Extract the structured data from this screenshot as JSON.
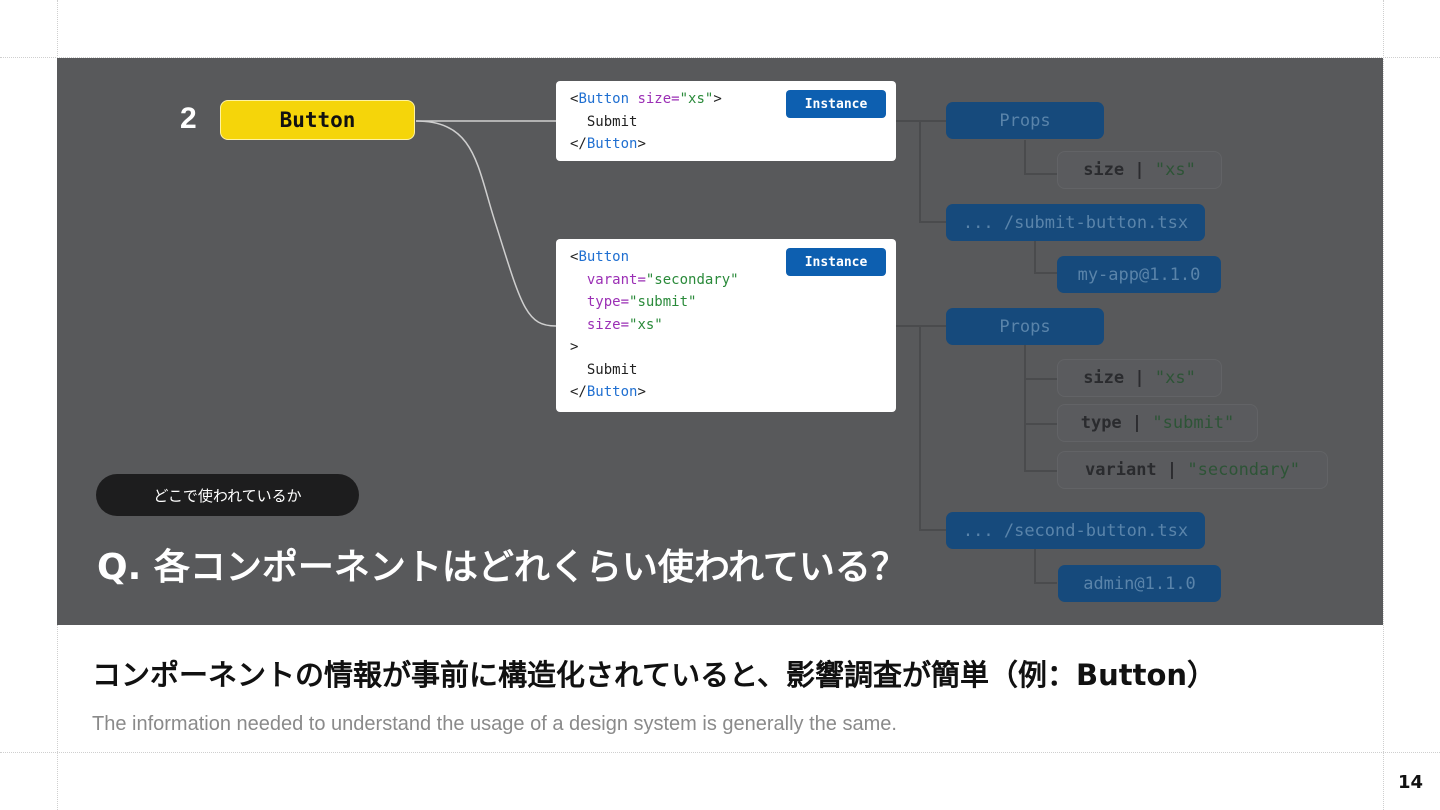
{
  "diagram": {
    "index": "2",
    "component": "Button",
    "instances": [
      {
        "badge": "Instance",
        "code": [
          "<",
          "Button",
          " ",
          "size",
          "=",
          "\"xs\"",
          ">",
          "Submit",
          "</",
          "Button",
          ">"
        ]
      },
      {
        "badge": "Instance",
        "code": [
          "<",
          "Button",
          "varant",
          "=",
          "\"secondary\"",
          "type",
          "=",
          "\"submit\"",
          "size",
          "=",
          "\"xs\"",
          ">",
          "Submit",
          "</",
          "Button",
          ">"
        ]
      }
    ],
    "tree1": {
      "props_label": "Props",
      "props": [
        {
          "key": "size",
          "sep": " | ",
          "value": "\"xs\""
        }
      ],
      "file": "... /submit-button.tsx",
      "package": "my-app@1.1.0"
    },
    "tree2": {
      "props_label": "Props",
      "props": [
        {
          "key": "size",
          "sep": " | ",
          "value": "\"xs\""
        },
        {
          "key": "type",
          "sep": " | ",
          "value": "\"submit\""
        },
        {
          "key": "variant",
          "sep": " | ",
          "value": "\"secondary\""
        }
      ],
      "file": "... /second-button.tsx",
      "package": "admin@1.1.0"
    },
    "tag_pill": "どこで使われているか",
    "question": "Q. 各コンポーネントはどれくらい使われている？"
  },
  "slide": {
    "title": "コンポーネントの情報が事前に構造化されていると、影響調査が簡単（例：Button）",
    "subtitle": "The information needed to understand the usage of a design system is generally the same.",
    "page_number": "14"
  }
}
